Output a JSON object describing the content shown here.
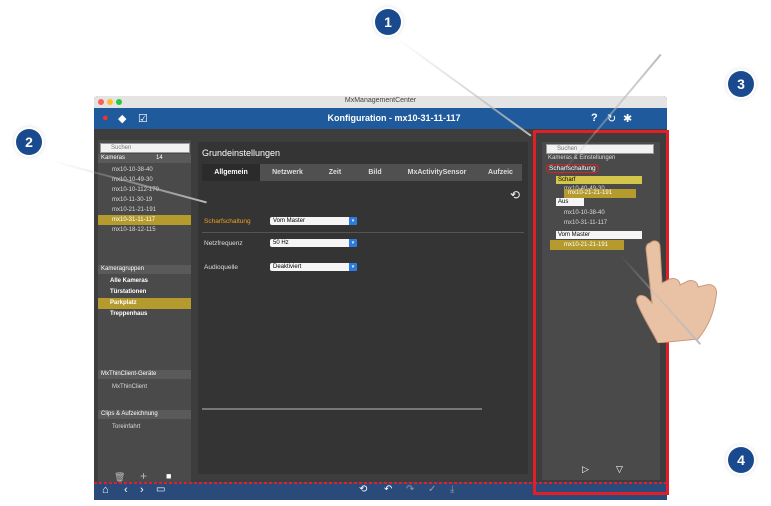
{
  "window": {
    "app_title": "MxManagementCenter",
    "page_title": "Konfiguration - mx10-31-11-117"
  },
  "left_panel": {
    "search_placeholder": "Suchen",
    "cameras_header": "Kameras",
    "cameras_count": "14",
    "cameras": [
      "mx10-10-38-40",
      "mx10-10-49-30",
      "mx10-10-112-170",
      "mx10-11-30-19",
      "mx10-21-21-191",
      "mx10-31-11-117",
      "mx10-18-12-115"
    ],
    "selected_camera": "mx10-31-11-117",
    "groups_header": "Kameragruppen",
    "groups": [
      "Alle Kameras",
      "Türstationen",
      "Parkplatz",
      "Treppenhaus"
    ],
    "selected_group": "Parkplatz",
    "thinclient_header": "MxThinClient-Geräte",
    "thinclient_item": "MxThinClient",
    "clips_header": "Clips & Aufzeichnung",
    "clips_item": "Toreinfahrt"
  },
  "center": {
    "heading": "Grundeinstellungen",
    "tabs": [
      "Allgemein",
      "Netzwerk",
      "Zeit",
      "Bild",
      "MxActivitySensor",
      "Aufzeic"
    ],
    "active_tab": "Allgemein",
    "settings": [
      {
        "label": "Scharfschaltung",
        "value": "Vom Master"
      },
      {
        "label": "Netzfrequenz",
        "value": "50 Hz"
      },
      {
        "label": "Audioquelle",
        "value": "Deaktiviert"
      }
    ]
  },
  "right_panel": {
    "search_placeholder": "Suchen",
    "header": "Kameras & Einstellungen",
    "highlight_label": "Scharfschaltung",
    "group1_value": "Scharf",
    "group1_items": [
      "mx10-40-49-30"
    ],
    "drag_item": "mx10-21-21-191",
    "group2_value": "Aus",
    "group2_items": [
      "mx10-10-38-40",
      "mx10-31-11-117"
    ],
    "group3_value": "Vom Master",
    "group3_items": [
      "mx10-21-21-191"
    ]
  },
  "callouts": [
    "1",
    "2",
    "3",
    "4"
  ],
  "colors": {
    "accent_blue": "#1f5b9c",
    "callout": "#1a4a8e",
    "highlight": "#b59a2e",
    "frame_red": "#e21f26"
  }
}
